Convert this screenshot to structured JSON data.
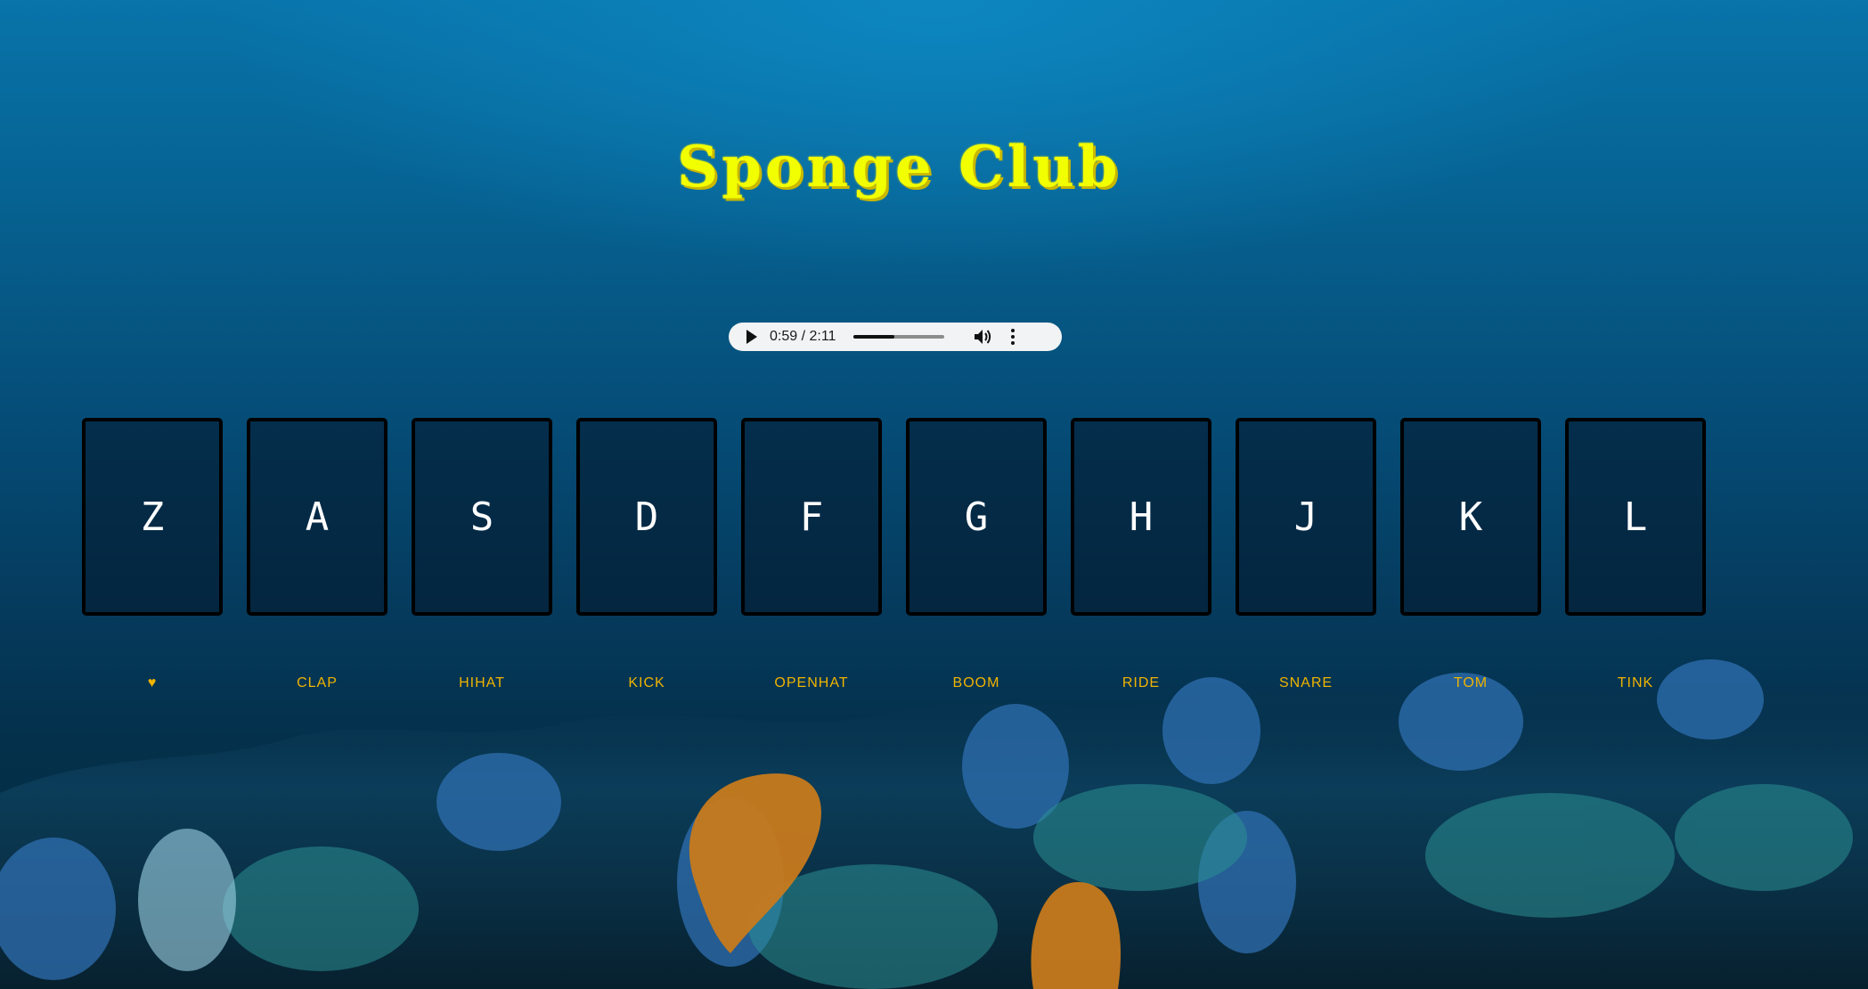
{
  "page": {
    "title": "Sponge Club",
    "title_color": "#f2ff00",
    "label_color": "#f0b400"
  },
  "audio": {
    "time_display": "0:59 / 2:11",
    "progress_fraction": 0.45,
    "play_icon": "play-icon",
    "volume_icon": "volume-icon",
    "more_icon": "more-options-icon"
  },
  "drum_pads": [
    {
      "key": "Z",
      "sound": "♥"
    },
    {
      "key": "A",
      "sound": "CLAP"
    },
    {
      "key": "S",
      "sound": "HIHAT"
    },
    {
      "key": "D",
      "sound": "KICK"
    },
    {
      "key": "F",
      "sound": "OPENHAT"
    },
    {
      "key": "G",
      "sound": "BOOM"
    },
    {
      "key": "H",
      "sound": "RIDE"
    },
    {
      "key": "J",
      "sound": "SNARE"
    },
    {
      "key": "K",
      "sound": "TOM"
    },
    {
      "key": "L",
      "sound": "TINK"
    }
  ]
}
